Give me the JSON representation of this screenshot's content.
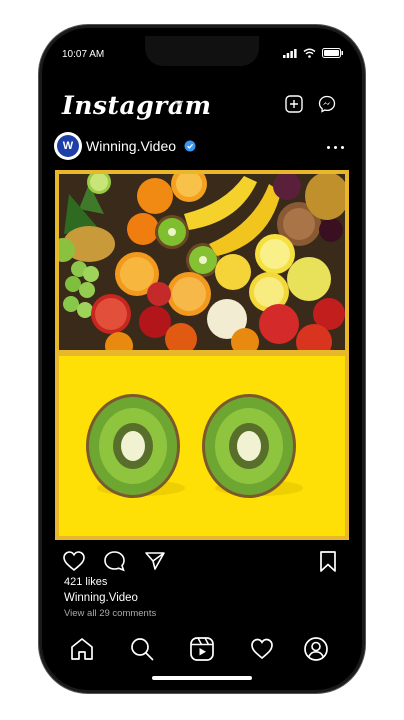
{
  "status_bar": {
    "time": "10:07 AM"
  },
  "app": {
    "logo_text": "Instagram"
  },
  "post": {
    "username": "Winning.Video",
    "avatar_letter": "W",
    "likes": "421 likes",
    "caption_username": "Winning.Video",
    "comments_link": "View all 29 comments"
  },
  "icons": {
    "header": [
      "chevron-down-icon",
      "new-post-icon",
      "messenger-icon"
    ],
    "actions": [
      "heart-icon",
      "comment-icon",
      "share-icon",
      "bookmark-icon"
    ],
    "nav": [
      "home-icon",
      "search-icon",
      "reels-icon",
      "activity-heart-icon",
      "profile-icon"
    ]
  },
  "colors": {
    "background": "#000000",
    "media_border": "#e8b82a",
    "kiwi_backdrop": "#fee007",
    "verified": "#3897f0",
    "avatar": "#1f3fa8"
  }
}
